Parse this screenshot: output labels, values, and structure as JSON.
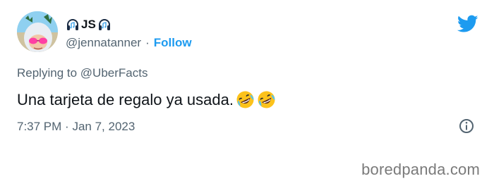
{
  "tweet": {
    "display_name": "JS",
    "handle": "@jennatanner",
    "separator": "·",
    "follow_label": "Follow",
    "replying_prefix": "Replying to",
    "replying_to": "@UberFacts",
    "text": "Una tarjeta de regalo ya usada.",
    "emojis": [
      "rofl-emoji",
      "rofl-emoji"
    ],
    "time": "7:37 PM",
    "date": "Jan 7, 2023",
    "brand_icon": "twitter-bird-icon",
    "info_icon": "info-icon"
  },
  "watermark": {
    "text": "boredpanda.com"
  },
  "colors": {
    "accent": "#1d9bf0",
    "text_primary": "#0f1419",
    "text_secondary": "#536471",
    "watermark": "#7a7a7a"
  }
}
